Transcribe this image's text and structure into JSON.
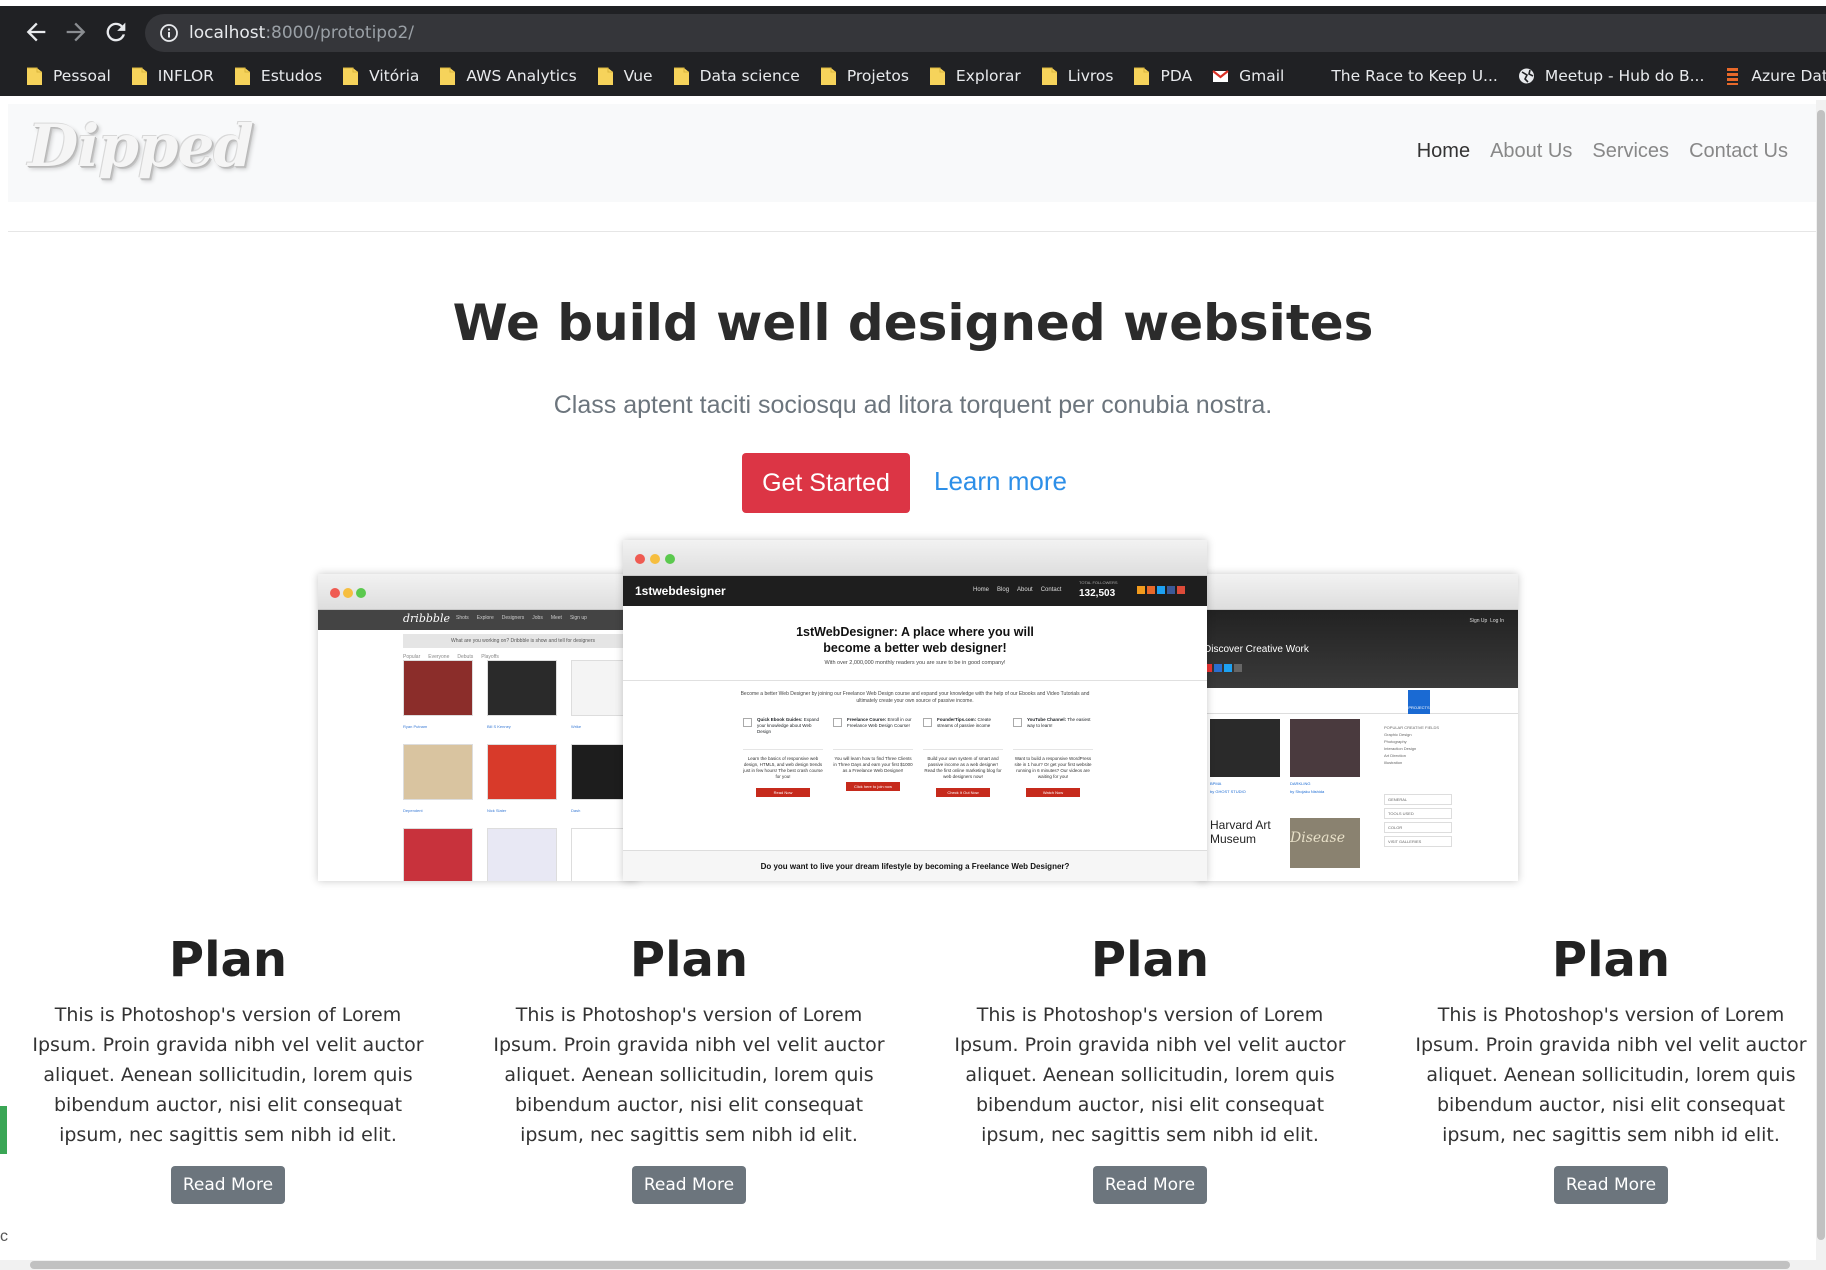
{
  "browser": {
    "url_host": "localhost",
    "url_path": ":8000/prototipo2/",
    "bookmarks": [
      {
        "label": "Pessoal",
        "icon": "folder-icon"
      },
      {
        "label": "INFLOR",
        "icon": "folder-icon"
      },
      {
        "label": "Estudos",
        "icon": "folder-icon"
      },
      {
        "label": "Vitória",
        "icon": "folder-icon"
      },
      {
        "label": "AWS Analytics",
        "icon": "folder-icon"
      },
      {
        "label": "Vue",
        "icon": "folder-icon"
      },
      {
        "label": "Data science",
        "icon": "folder-icon"
      },
      {
        "label": "Projetos",
        "icon": "folder-icon"
      },
      {
        "label": "Explorar",
        "icon": "folder-icon"
      },
      {
        "label": "Livros",
        "icon": "folder-icon"
      },
      {
        "label": "PDA",
        "icon": "folder-icon"
      },
      {
        "label": "Gmail",
        "icon": "gmail-icon"
      },
      {
        "label": "The Race to Keep U...",
        "icon": "red-crescent-icon"
      },
      {
        "label": "Meetup - Hub do B...",
        "icon": "globe-icon"
      },
      {
        "label": "Azure Data Week -...",
        "icon": "stack-icon"
      }
    ]
  },
  "site": {
    "brand": "Dipped",
    "nav": [
      "Home",
      "About Us",
      "Services",
      "Contact Us"
    ],
    "hero": {
      "title": "We build well designed websites",
      "subtitle": "Class aptent taciti sociosqu ad litora torquent per conubia nostra.",
      "primary_button": "Get Started",
      "secondary_link": "Learn more"
    },
    "mockups": {
      "center": {
        "logo": "1stwebdesigner",
        "nav": [
          "Home",
          "Blog",
          "About",
          "Contact"
        ],
        "followers_label": "TOTAL FOLLOWERS",
        "followers": "132,503",
        "headline": "1stWebDesigner: A place where you will become a better web designer!",
        "tagline": "With over 2,000,000 monthly readers you are sure to be in good company!",
        "intro": "Become a better Web Designer by joining our Freelance Web Design course and expand your knowledge with the help of our Ebooks and Video Tutorials and ultimately create your own source of passive income.",
        "features": [
          {
            "title": "Quick Ebook Guides:",
            "desc": "Expand your knowledge about Web Design",
            "body": "Learn the basics of responsive web design, HTML5, and web design trends just in few hours! The best crash course for you!",
            "cta": "Read Now"
          },
          {
            "title": "Freelance Course:",
            "desc": "Enroll in our Freelance Web Design Course!",
            "body": "You will learn how to find Three Clients in Three Days and earn your first $1000 as a Freelance Web Designer!",
            "cta": "Click here to join now"
          },
          {
            "title": "FounderTips.com:",
            "desc": "Create streams of passive income",
            "body": "Build your own system of smart and passive income as a web designer! Read the first online marketing blog for web designers now!",
            "cta": "Check It Out Now"
          },
          {
            "title": "YouTube Channel:",
            "desc": "The easiest way to learn!",
            "body": "Want to build a responsive WordPress site in 1 hour? Or get your first website running in 6 minutes? Our videos are waiting for you!",
            "cta": "Watch Now"
          }
        ],
        "footer_line": "Do you want to live your dream lifestyle by becoming a Freelance Web Designer?"
      },
      "left": {
        "logo": "dribbble",
        "nav": [
          "Shots",
          "Explore",
          "Designers",
          "Jobs",
          "Meet",
          "Sign up"
        ],
        "banner": "What are you working on? Dribbble is show and tell for designers",
        "tabs": [
          "Popular",
          "Everyone",
          "Debuts",
          "Playoffs"
        ],
        "authors": [
          "Ryan Putnam",
          "Bill S Kenney",
          "Wrike",
          "Dependent",
          "Nick Slater",
          "Dash"
        ]
      },
      "right": {
        "nav": [
          "Sign Up",
          "Log In"
        ],
        "heading": "Discover Creative Work",
        "tab": "PROJECTS",
        "tiles": [
          {
            "title": "BPMA",
            "by": "by GHOST STUDIO"
          },
          {
            "title": "DARKLING",
            "by": "by Shojaku Nishida"
          }
        ],
        "thumb_captions": [
          "Harvard Art Museum",
          "Disease"
        ],
        "sidebar": [
          "POPULAR CREATIVE FIELDS",
          "Graphic Design",
          "Photography",
          "Interaction Design",
          "Art Direction",
          "Illustration"
        ],
        "filters": [
          "GENERAL",
          "TOOLS USED",
          "COLOR",
          "VISIT GALLERIES"
        ]
      }
    },
    "plans": [
      {
        "title": "Plan",
        "text": "This is Photoshop's version of Lorem Ipsum. Proin gravida nibh vel velit auctor aliquet. Aenean sollicitudin, lorem quis bibendum auctor, nisi elit consequat ipsum, nec sagittis sem nibh id elit.",
        "button": "Read More"
      },
      {
        "title": "Plan",
        "text": "This is Photoshop's version of Lorem Ipsum. Proin gravida nibh vel velit auctor aliquet. Aenean sollicitudin, lorem quis bibendum auctor, nisi elit consequat ipsum, nec sagittis sem nibh id elit.",
        "button": "Read More"
      },
      {
        "title": "Plan",
        "text": "This is Photoshop's version of Lorem Ipsum. Proin gravida nibh vel velit auctor aliquet. Aenean sollicitudin, lorem quis bibendum auctor, nisi elit consequat ipsum, nec sagittis sem nibh id elit.",
        "button": "Read More"
      },
      {
        "title": "Plan",
        "text": "This is Photoshop's version of Lorem Ipsum. Proin gravida nibh vel velit auctor aliquet. Aenean sollicitudin, lorem quis bibendum auctor, nisi elit consequat ipsum, nec sagittis sem nibh id elit.",
        "button": "Read More"
      }
    ]
  },
  "misc": {
    "edge_glyph": "c"
  },
  "colors": {
    "chrome_bg": "#202124",
    "primary": "#dc3545",
    "link": "#2d8fe8",
    "secondary": "#6c757d",
    "navbar_bg": "#f8f9fa"
  }
}
